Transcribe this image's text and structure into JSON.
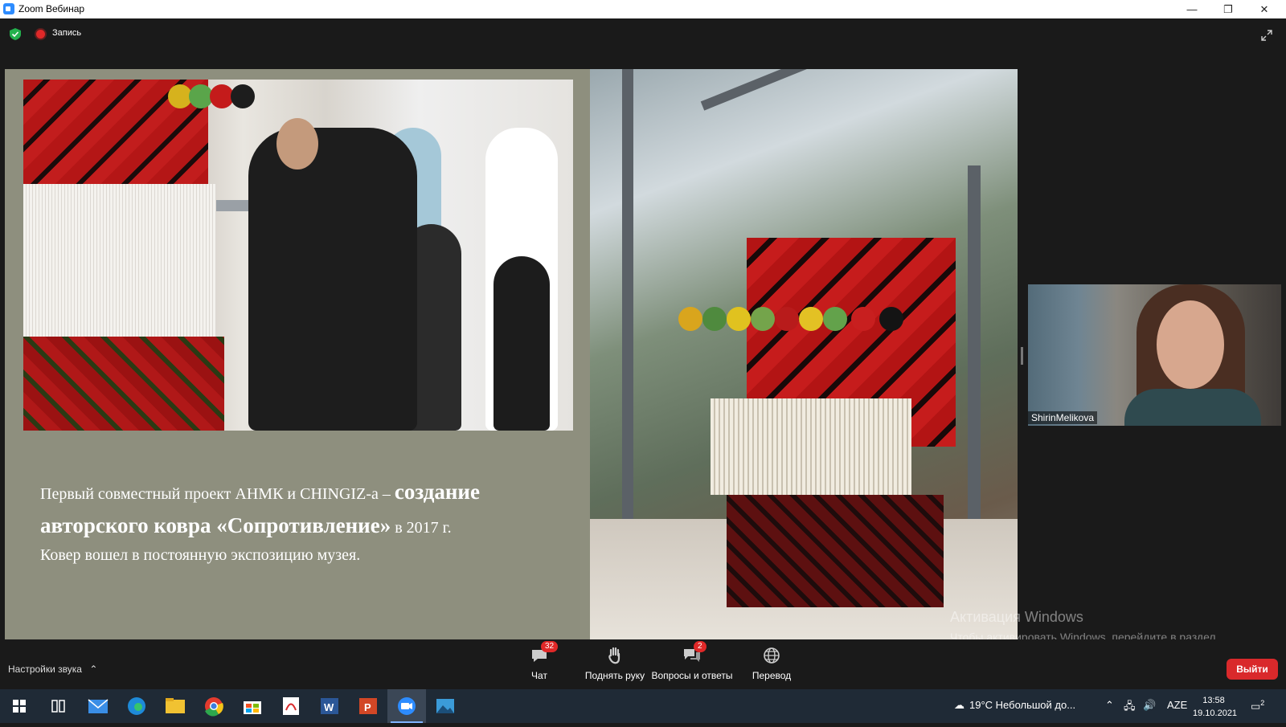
{
  "window": {
    "title": "Zoom Вебинар",
    "minimize": "—",
    "restore": "❐",
    "close": "✕"
  },
  "topbar": {
    "recording_label": "Запись",
    "icons": [
      "shield-check-icon",
      "record-icon",
      "fullscreen-icon"
    ]
  },
  "slide": {
    "text_line1_regular": "Первый совместный проект АНМК и CHINGIZ-а – ",
    "text_line1_bold": "создание",
    "text_line2_bold": "авторского ковра «Сопротивление»",
    "text_line2_regular": " в 2017 г.",
    "text_line3": "Ковер вошел в постоянную экспозицию музея."
  },
  "participant": {
    "name": "ShirinMelikova"
  },
  "watermark": {
    "title": "Активация Windows",
    "body": "Чтобы активировать Windows, перейдите в раздел \"Параметры\"."
  },
  "toolbar": {
    "audio_settings": "Настройки звука",
    "chat_label": "Чат",
    "chat_badge": "32",
    "raise_hand_label": "Поднять руку",
    "qa_label": "Вопросы и ответы",
    "qa_badge": "2",
    "translate_label": "Перевод",
    "leave_label": "Выйти"
  },
  "taskbar": {
    "weather": "19°C  Небольшой до...",
    "language": "AZE",
    "time": "13:58",
    "date": "19.10.2021",
    "notifications": "2",
    "apps": [
      "windows-start-icon",
      "task-view-icon",
      "mail-icon",
      "edge-icon",
      "file-explorer-icon",
      "chrome-icon",
      "store-icon",
      "pdf-icon",
      "word-icon",
      "powerpoint-icon",
      "zoom-icon",
      "photos-icon"
    ]
  },
  "colors": {
    "zoom_blue": "#2d8cff",
    "leave_red": "#d9292b",
    "badge_red": "#e02828",
    "slide_bg": "#8e8f7e",
    "taskbar_bg": "#1f2a36"
  }
}
